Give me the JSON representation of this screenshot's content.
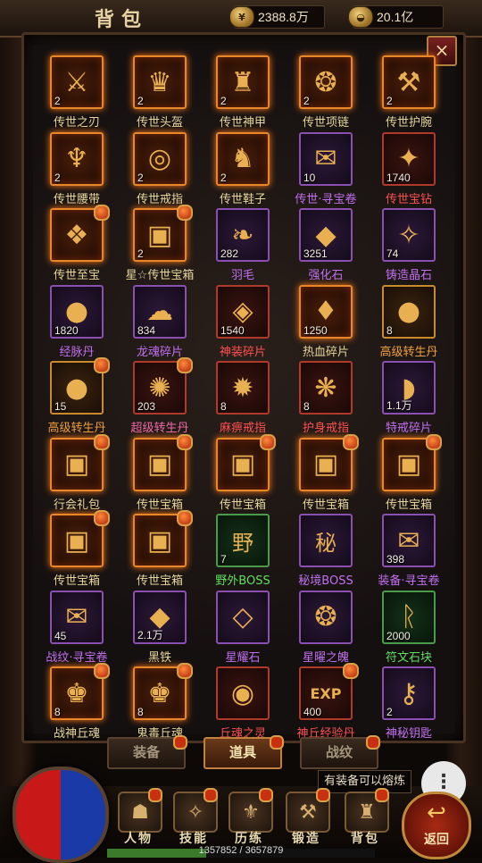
{
  "header": {
    "title": "背包",
    "gold": {
      "icon": "gold-coin-icon",
      "value": "2388.8万"
    },
    "ingot": {
      "icon": "gold-ingot-icon",
      "value": "20.1亿"
    },
    "close_label": "×"
  },
  "items": [
    {
      "name": "传世之刃",
      "count": "2",
      "glyph": "⚔",
      "frame": "fire",
      "color": "default"
    },
    {
      "name": "传世头盔",
      "count": "2",
      "glyph": "♛",
      "frame": "fire",
      "color": "default"
    },
    {
      "name": "传世神甲",
      "count": "2",
      "glyph": "♜",
      "frame": "fire",
      "color": "default"
    },
    {
      "name": "传世项链",
      "count": "2",
      "glyph": "❂",
      "frame": "fire",
      "color": "default"
    },
    {
      "name": "传世护腕",
      "count": "2",
      "glyph": "⚒",
      "frame": "fire",
      "color": "default"
    },
    {
      "name": "传世腰带",
      "count": "2",
      "glyph": "♆",
      "frame": "fire",
      "color": "default"
    },
    {
      "name": "传世戒指",
      "count": "2",
      "glyph": "◎",
      "frame": "fire",
      "color": "default"
    },
    {
      "name": "传世鞋子",
      "count": "2",
      "glyph": "♞",
      "frame": "fire",
      "color": "default"
    },
    {
      "name": "传世·寻宝卷",
      "count": "10",
      "glyph": "✉",
      "frame": "purple",
      "color": "purple"
    },
    {
      "name": "传世宝钻",
      "count": "1740",
      "glyph": "✦",
      "frame": "red",
      "color": "red"
    },
    {
      "name": "传世至宝",
      "count": "",
      "glyph": "❖",
      "frame": "fire",
      "color": "default",
      "dot": true
    },
    {
      "name": "星☆传世宝箱",
      "count": "2",
      "glyph": "▣",
      "frame": "fire",
      "color": "default",
      "dot": true
    },
    {
      "name": "羽毛",
      "count": "282",
      "glyph": "❧",
      "frame": "purple",
      "color": "purple"
    },
    {
      "name": "强化石",
      "count": "3251",
      "glyph": "◆",
      "frame": "purple",
      "color": "purple"
    },
    {
      "name": "铸造晶石",
      "count": "74",
      "glyph": "✧",
      "frame": "purple",
      "color": "purple"
    },
    {
      "name": "经脉丹",
      "count": "1820",
      "glyph": "●",
      "frame": "purple",
      "color": "purple"
    },
    {
      "name": "龙魂碎片",
      "count": "834",
      "glyph": "☁",
      "frame": "purple",
      "color": "purple"
    },
    {
      "name": "神装碎片",
      "count": "1540",
      "glyph": "◈",
      "frame": "red",
      "color": "red"
    },
    {
      "name": "热血碎片",
      "count": "1250",
      "glyph": "♦",
      "frame": "fire",
      "color": "default"
    },
    {
      "name": "高级转生丹",
      "count": "8",
      "glyph": "●",
      "frame": "gold",
      "color": "orange"
    },
    {
      "name": "高级转生丹",
      "count": "15",
      "glyph": "●",
      "frame": "gold",
      "color": "orange",
      "dot": true
    },
    {
      "name": "超级转生丹",
      "count": "203",
      "glyph": "✺",
      "frame": "red",
      "color": "pink",
      "dot": true
    },
    {
      "name": "麻痹戒指",
      "count": "8",
      "glyph": "✹",
      "frame": "red",
      "color": "red"
    },
    {
      "name": "护身戒指",
      "count": "8",
      "glyph": "❋",
      "frame": "red",
      "color": "red"
    },
    {
      "name": "特戒碎片",
      "count": "1.1万",
      "glyph": "◗",
      "frame": "purple",
      "color": "purple"
    },
    {
      "name": "行会礼包",
      "count": "",
      "glyph": "▣",
      "frame": "fire",
      "color": "default",
      "dot": true
    },
    {
      "name": "传世宝箱",
      "count": "",
      "glyph": "▣",
      "frame": "fire",
      "color": "default",
      "dot": true
    },
    {
      "name": "传世宝箱",
      "count": "",
      "glyph": "▣",
      "frame": "fire",
      "color": "default",
      "dot": true
    },
    {
      "name": "传世宝箱",
      "count": "",
      "glyph": "▣",
      "frame": "fire",
      "color": "default",
      "dot": true
    },
    {
      "name": "传世宝箱",
      "count": "",
      "glyph": "▣",
      "frame": "fire",
      "color": "default",
      "dot": true
    },
    {
      "name": "传世宝箱",
      "count": "",
      "glyph": "▣",
      "frame": "fire",
      "color": "default",
      "dot": true
    },
    {
      "name": "传世宝箱",
      "count": "",
      "glyph": "▣",
      "frame": "fire",
      "color": "default",
      "dot": true
    },
    {
      "name": "野外BOSS",
      "count": "7",
      "glyph": "野",
      "frame": "green",
      "color": "green"
    },
    {
      "name": "秘境BOSS",
      "count": "",
      "glyph": "秘",
      "frame": "purple",
      "color": "purple"
    },
    {
      "name": "装备·寻宝卷",
      "count": "398",
      "glyph": "✉",
      "frame": "purple",
      "color": "purple"
    },
    {
      "name": "战纹·寻宝卷",
      "count": "45",
      "glyph": "✉",
      "frame": "purple",
      "color": "purple"
    },
    {
      "name": "黑铁",
      "count": "2.1万",
      "glyph": "◆",
      "frame": "purple",
      "color": "default"
    },
    {
      "name": "星耀石",
      "count": "",
      "glyph": "◇",
      "frame": "purple",
      "color": "purple"
    },
    {
      "name": "星曜之魄",
      "count": "",
      "glyph": "❂",
      "frame": "purple",
      "color": "purple"
    },
    {
      "name": "符文石块",
      "count": "2000",
      "glyph": "ᚱ",
      "frame": "green",
      "color": "green"
    },
    {
      "name": "战神丘魂",
      "count": "8",
      "glyph": "♚",
      "frame": "fire",
      "color": "default",
      "dot": true
    },
    {
      "name": "鬼毒丘魂",
      "count": "8",
      "glyph": "♚",
      "frame": "fire",
      "color": "default",
      "dot": true
    },
    {
      "name": "丘魂之灵",
      "count": "",
      "glyph": "◉",
      "frame": "red",
      "color": "red"
    },
    {
      "name": "神丘经验丹",
      "count": "400",
      "glyph": "EXP",
      "frame": "red",
      "color": "red",
      "dot": true
    },
    {
      "name": "神秘钥匙",
      "count": "2",
      "glyph": "⚷",
      "frame": "purple",
      "color": "purple"
    }
  ],
  "tabs": [
    {
      "label": "装备",
      "active": false
    },
    {
      "label": "道具",
      "active": true
    },
    {
      "label": "战纹",
      "active": false
    }
  ],
  "hint": "有装备可以熔炼",
  "more_label": "⋮",
  "nav": [
    {
      "label": "人物",
      "icon": "character-icon",
      "glyph": "☗"
    },
    {
      "label": "技能",
      "icon": "skill-book-icon",
      "glyph": "✧"
    },
    {
      "label": "历练",
      "icon": "trial-icon",
      "glyph": "⚜"
    },
    {
      "label": "锻造",
      "icon": "anvil-icon",
      "glyph": "⚒"
    },
    {
      "label": "背包",
      "icon": "bag-icon",
      "glyph": "♜"
    }
  ],
  "back": {
    "label": "返回",
    "glyph": "↩"
  },
  "exp": {
    "text": "1357852 / 3657879",
    "fraction": 0.371
  }
}
